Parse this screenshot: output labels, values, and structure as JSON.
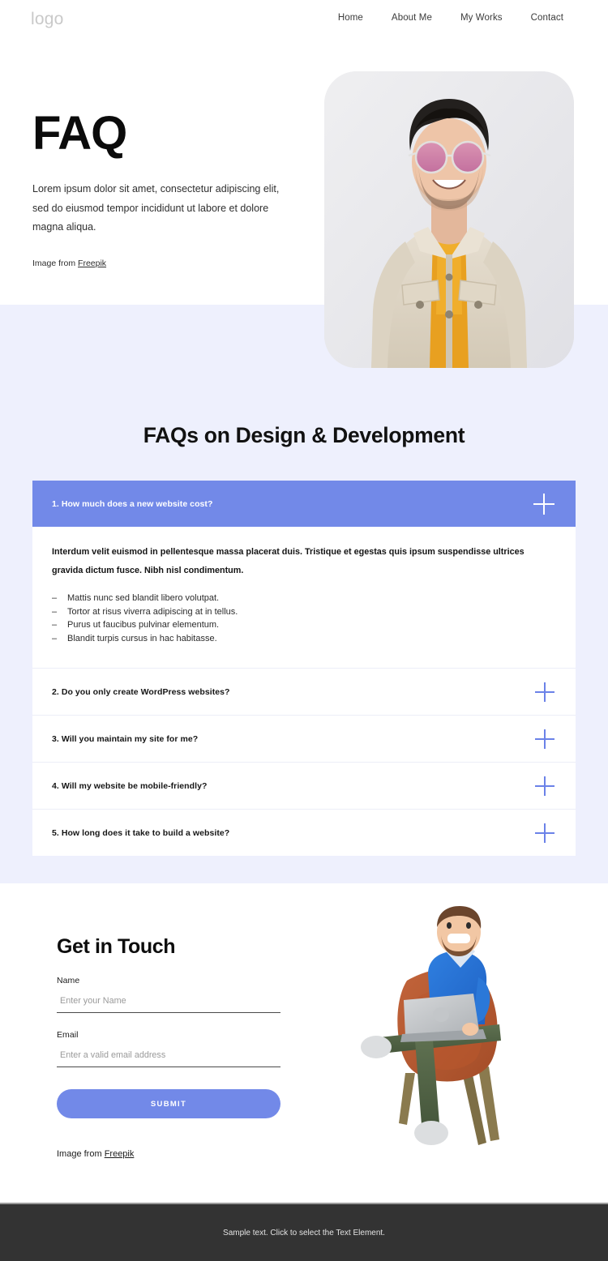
{
  "header": {
    "logo": "logo",
    "nav": [
      {
        "label": "Home"
      },
      {
        "label": "About Me"
      },
      {
        "label": "My Works"
      },
      {
        "label": "Contact"
      }
    ]
  },
  "hero": {
    "title": "FAQ",
    "paragraph": "Lorem ipsum dolor sit amet, consectetur adipiscing elit, sed do eiusmod tempor incididunt ut labore et dolore magna aliqua.",
    "credit_prefix": "Image from ",
    "credit_link": "Freepik",
    "image_alt": "smiling-man-in-sunglasses-and-beige-jacket"
  },
  "faq": {
    "heading": "FAQs on Design & Development",
    "items": [
      {
        "question": "1. How much does a new website cost?",
        "open": true,
        "answer_lead": "Interdum velit euismod in pellentesque massa placerat duis. Tristique et egestas quis ipsum suspendisse ultrices gravida dictum fusce. Nibh nisl condimentum.",
        "answer_bullets": [
          "Mattis nunc sed blandit libero volutpat.",
          "Tortor at risus viverra adipiscing at in tellus.",
          "Purus ut faucibus pulvinar elementum.",
          "Blandit turpis cursus in hac habitasse."
        ]
      },
      {
        "question": "2. Do you only create WordPress websites?",
        "open": false
      },
      {
        "question": "3. Will you maintain my site for me?",
        "open": false
      },
      {
        "question": "4. Will my website be mobile-friendly?",
        "open": false
      },
      {
        "question": "5. How long does it take to build a website?",
        "open": false
      }
    ]
  },
  "contact": {
    "title": "Get in Touch",
    "name_label": "Name",
    "name_placeholder": "Enter your Name",
    "name_value": "",
    "email_label": "Email",
    "email_placeholder": "Enter a valid email address",
    "email_value": "",
    "submit_label": "SUBMIT",
    "credit_prefix": "Image from ",
    "credit_link": "Freepik",
    "illustration_alt": "3d-character-sitting-in-armchair-with-laptop"
  },
  "footer": {
    "text": "Sample text. Click to select the Text Element."
  },
  "colors": {
    "accent": "#7289e8",
    "plus_icon": "#6b82e8",
    "faq_section_bg": "#eef0fd",
    "footer_bg": "#333333",
    "hero_card_bg": "#e9e9ec"
  }
}
